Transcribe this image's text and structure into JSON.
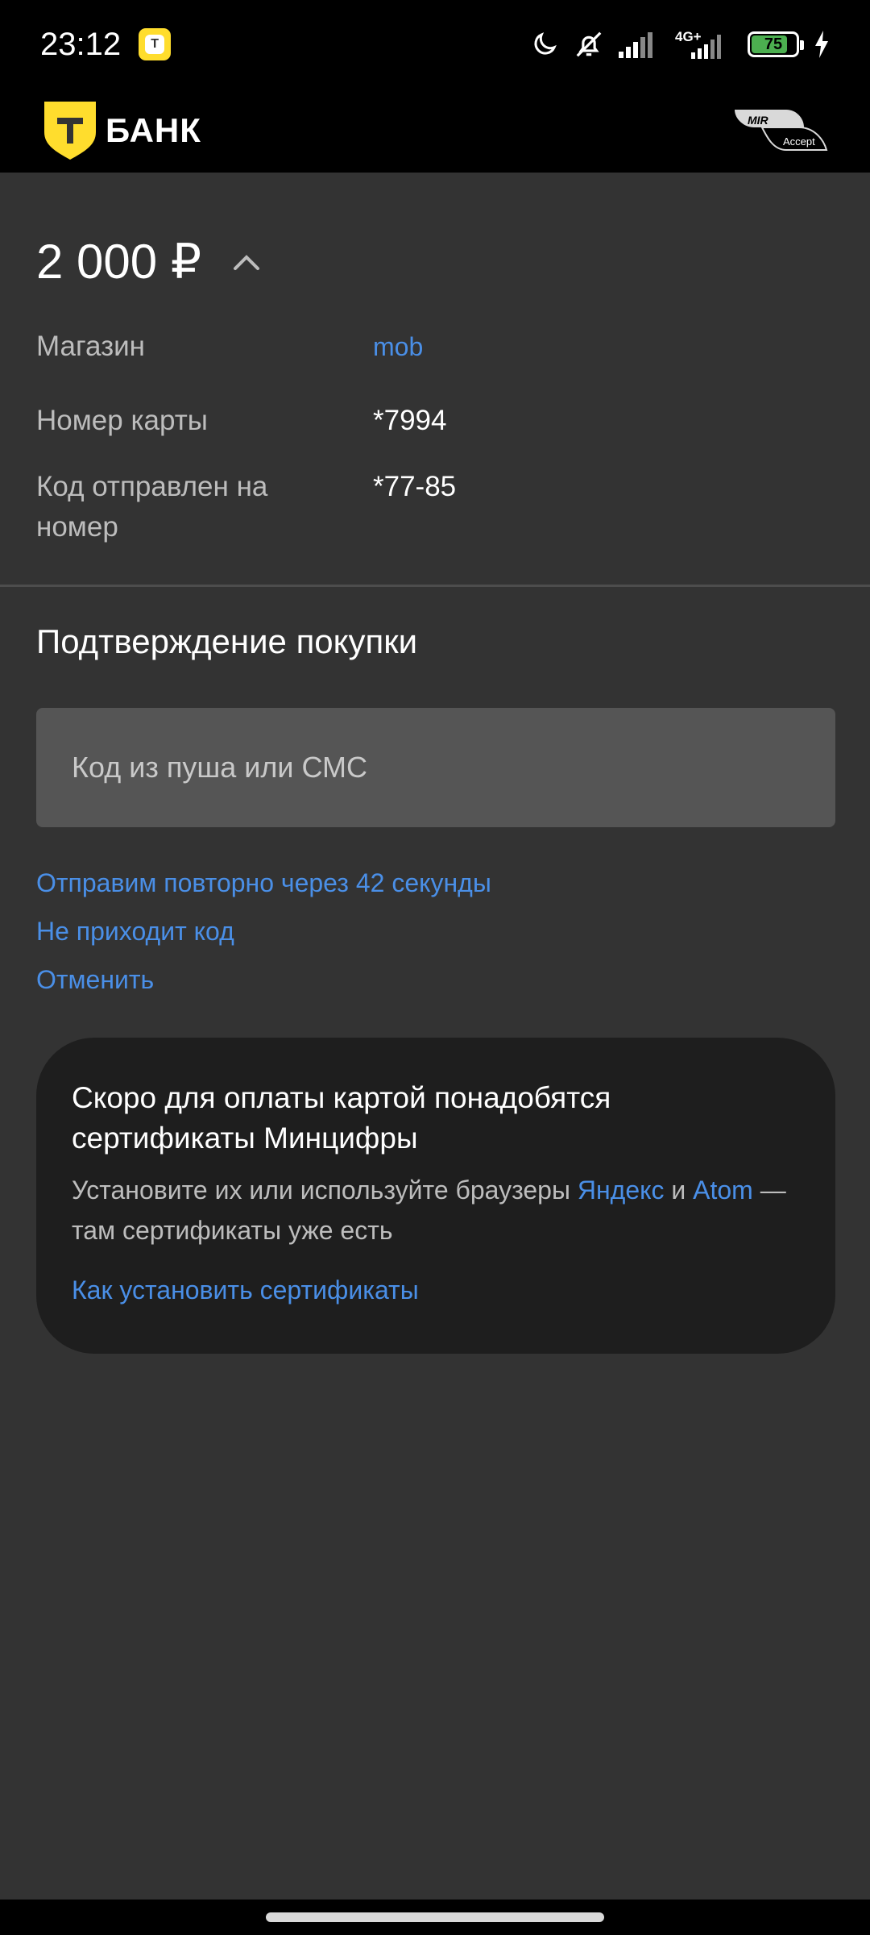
{
  "status_bar": {
    "time": "23:12",
    "app_icon_letter": "T",
    "network": "4G+",
    "battery_level": "75",
    "battery_percent": 75,
    "icons": [
      "moon-icon",
      "bell-off-icon",
      "signal-icon",
      "signal-4g-icon",
      "battery-icon",
      "charging-icon"
    ]
  },
  "header": {
    "brand_letter": "Т",
    "brand_name": "БАНК",
    "mir_label": "MIR",
    "accept_label": "Accept",
    "brand_color": "#ffdd2d"
  },
  "payment": {
    "amount": "2 000 ₽",
    "details": [
      {
        "label": "Магазин",
        "value": "mob"
      },
      {
        "label": "Номер карты",
        "value": "*7994"
      },
      {
        "label": "Код отправлен на номер",
        "value": "*77-85"
      }
    ]
  },
  "confirmation": {
    "title": "Подтверждение покупки",
    "input_placeholder": "Код из пуша или СМС",
    "input_value": "",
    "resend_text": "Отправим повторно через 42 секунды",
    "no_code_link": "Не приходит код",
    "cancel_link": "Отменить"
  },
  "info_card": {
    "title": "Скоро для оплаты картой понадобятся сертификаты Минцифры",
    "text_before": "Установите их или используйте браузеры ",
    "link_yandex": "Яндекс",
    "text_and": " и ",
    "link_atom": "Atom",
    "text_after": " — там сертификаты уже есть",
    "install_link": "Как установить сертификаты"
  },
  "colors": {
    "accent_link": "#4a8fe7",
    "background": "#333333",
    "card_background": "#1e1e1e"
  }
}
